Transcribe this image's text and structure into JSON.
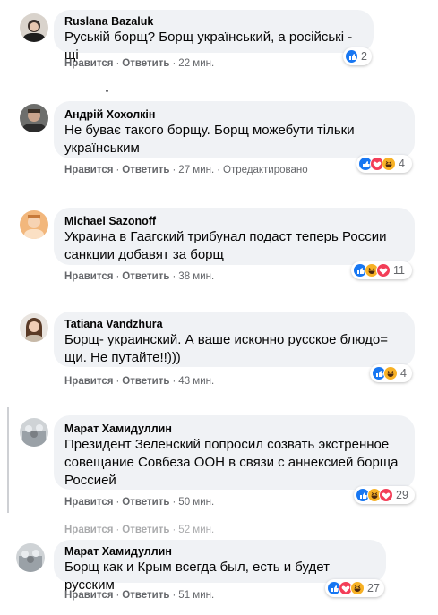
{
  "comments": [
    {
      "author": "Ruslana Bazaluk",
      "text": "Руській борщ? Борщ український, а російські - щі",
      "like": "Нравится",
      "reply": "Ответить",
      "time": "22 мин.",
      "edited": "",
      "count": "2",
      "reactions": [
        "like"
      ]
    },
    {
      "author": "Андрій Хохолкін",
      "text": "Не буває такого борщу. Борщ можебути тільки українським",
      "like": "Нравится",
      "reply": "Ответить",
      "time": "27 мин.",
      "edited": "Отредактировано",
      "count": "4",
      "reactions": [
        "like",
        "love",
        "haha"
      ]
    },
    {
      "author": "Michael Sazonoff",
      "text": "Украина в Гаагский трибунал подаст теперь России санкции добавят за борщ",
      "like": "Нравится",
      "reply": "Ответить",
      "time": "38 мин.",
      "edited": "",
      "count": "11",
      "reactions": [
        "like",
        "haha",
        "love"
      ]
    },
    {
      "author": "Tatiana Vandzhura",
      "text": "Борщ- украинский. А ваше исконно русское блюдо= щи. Не путайте!!)))",
      "like": "Нравится",
      "reply": "Ответить",
      "time": "43 мин.",
      "edited": "",
      "count": "4",
      "reactions": [
        "like",
        "haha"
      ]
    },
    {
      "author": "Марат Хамидуллин",
      "text": "Президент Зеленский попросил созвать экстренное совещание Совбеза ООН в связи с аннексией борща Россией",
      "like": "Нравится",
      "reply": "Ответить",
      "time": "50 мин.",
      "edited": "",
      "count": "29",
      "reactions": [
        "like",
        "haha",
        "love"
      ]
    },
    {
      "author": "",
      "text": "",
      "like": "Нравится",
      "reply": "Ответить",
      "time": "52 мин.",
      "edited": "",
      "count": "",
      "reactions": []
    },
    {
      "author": "Марат Хамидуллин",
      "text": "Борщ как и Крым всегда был, есть и будет русским",
      "like": "Нравится",
      "reply": "Ответить",
      "time": "51 мин.",
      "edited": "",
      "count": "27",
      "reactions": [
        "like",
        "love",
        "haha"
      ]
    }
  ],
  "colors": {
    "like": "#1877f2",
    "love": "#f33e58",
    "haha": "#f7b125",
    "bubble": "#f0f2f5",
    "meta": "#65676b"
  }
}
